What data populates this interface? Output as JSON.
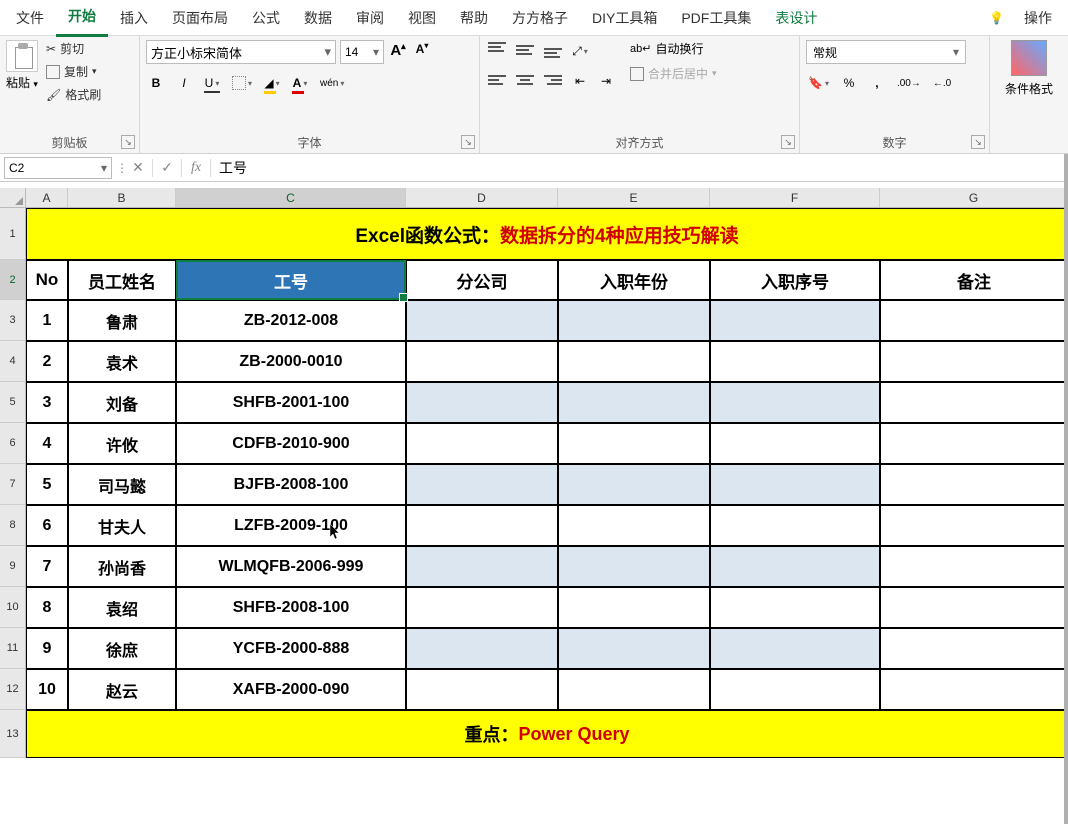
{
  "menu": {
    "tabs": [
      "文件",
      "开始",
      "插入",
      "页面布局",
      "公式",
      "数据",
      "审阅",
      "视图",
      "帮助",
      "方方格子",
      "DIY工具箱",
      "PDF工具集",
      "表设计"
    ],
    "active_index": 1,
    "help_label": "操作"
  },
  "ribbon": {
    "clipboard": {
      "paste": "粘贴",
      "cut": "剪切",
      "copy": "复制",
      "format_painter": "格式刷",
      "group": "剪贴板"
    },
    "font": {
      "name": "方正小标宋简体",
      "size": "14",
      "group": "字体",
      "bold": "B",
      "italic": "I",
      "underline": "U",
      "phonetic": "wén"
    },
    "alignment": {
      "wrap": "自动换行",
      "merge": "合并后居中",
      "group": "对齐方式"
    },
    "number": {
      "format": "常规",
      "group": "数字",
      "percent": "%",
      "comma": ","
    },
    "styles": {
      "cond_format": "条件格式"
    }
  },
  "formula_bar": {
    "name_box": "C2",
    "formula": "工号"
  },
  "grid": {
    "columns": [
      "A",
      "B",
      "C",
      "D",
      "E",
      "F",
      "G"
    ],
    "selected_col": "C",
    "title": {
      "prefix": "Excel函数公式：",
      "main": "数据拆分的4种应用技巧解读"
    },
    "headers": [
      "No",
      "员工姓名",
      "工号",
      "分公司",
      "入职年份",
      "入职序号",
      "备注"
    ],
    "rows": [
      {
        "no": "1",
        "name": "鲁肃",
        "code": "ZB-2012-008"
      },
      {
        "no": "2",
        "name": "袁术",
        "code": "ZB-2000-0010"
      },
      {
        "no": "3",
        "name": "刘备",
        "code": "SHFB-2001-100"
      },
      {
        "no": "4",
        "name": "许攸",
        "code": "CDFB-2010-900"
      },
      {
        "no": "5",
        "name": "司马懿",
        "code": "BJFB-2008-100"
      },
      {
        "no": "6",
        "name": "甘夫人",
        "code": "LZFB-2009-100"
      },
      {
        "no": "7",
        "name": "孙尚香",
        "code": "WLMQFB-2006-999"
      },
      {
        "no": "8",
        "name": "袁绍",
        "code": "SHFB-2008-100"
      },
      {
        "no": "9",
        "name": "徐庶",
        "code": "YCFB-2000-888"
      },
      {
        "no": "10",
        "name": "赵云",
        "code": "XAFB-2000-090"
      }
    ],
    "tinted_rows": [
      0,
      2,
      4,
      6,
      8
    ],
    "footer": {
      "prefix": "重点：",
      "main": "Power Query"
    },
    "row_headers": [
      "1",
      "2",
      "3",
      "4",
      "5",
      "6",
      "7",
      "8",
      "9",
      "10",
      "11",
      "12",
      "13"
    ]
  }
}
